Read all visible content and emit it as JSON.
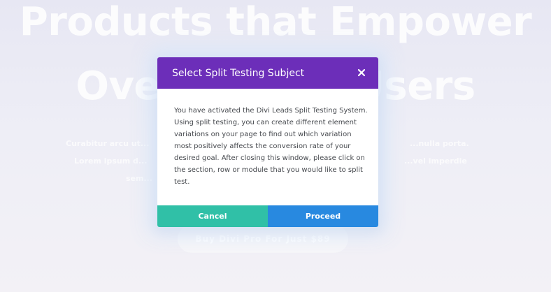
{
  "background": {
    "hero_title_line1": "Products that Empower",
    "hero_title_line2": "Overflowing Users",
    "desc_left_1": "Curabitur arcu ut...",
    "desc_left_2": "Lorem ipsum d...",
    "desc_left_3": "sem...",
    "desc_right_1": "...nulla porta.",
    "desc_right_2": "...vel imperdie",
    "cta_label": "Buy Divi Pro For Just $89"
  },
  "modal": {
    "title": "Select Split Testing Subject",
    "body": "You have activated the Divi Leads Split Testing System. Using split testing, you can create different element variations on your page to find out which variation most positively affects the conversion rate of your desired goal. After closing this window, please click on the section, row or module that you would like to split test.",
    "cancel_label": "Cancel",
    "proceed_label": "Proceed",
    "close_icon": "close-icon"
  },
  "colors": {
    "header": "#6c2eb9",
    "cancel": "#30c0a7",
    "proceed": "#2889e0",
    "body_text": "#45484d"
  }
}
